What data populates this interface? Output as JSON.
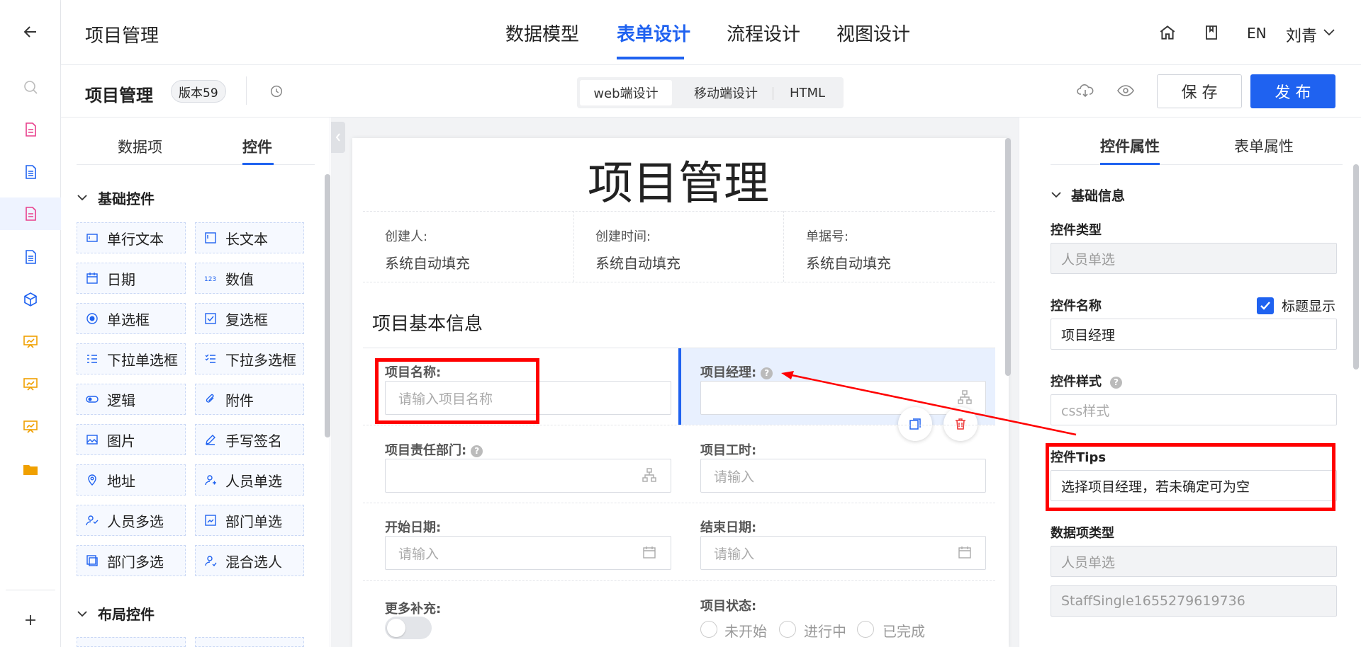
{
  "app": {
    "title": "项目管理"
  },
  "top_nav": {
    "items": [
      "数据模型",
      "表单设计",
      "流程设计",
      "视图设计"
    ],
    "active": "表单设计"
  },
  "header_right": {
    "lang": "EN",
    "user": "刘青"
  },
  "subheader": {
    "title": "项目管理",
    "version": "版本59",
    "modes": [
      "web端设计",
      "移动端设计",
      "HTML"
    ],
    "active_mode": "web端设计",
    "save_label": "保 存",
    "publish_label": "发 布"
  },
  "palette": {
    "tabs": [
      "数据项",
      "控件"
    ],
    "active_tab": "控件",
    "basic_title": "基础控件",
    "controls": [
      "单行文本",
      "长文本",
      "日期",
      "数值",
      "单选框",
      "复选框",
      "下拉单选框",
      "下拉多选框",
      "逻辑",
      "附件",
      "图片",
      "手写签名",
      "地址",
      "人员单选",
      "人员多选",
      "部门单选",
      "部门多选",
      "混合选人"
    ],
    "layout_title": "布局控件"
  },
  "form": {
    "title": "项目管理",
    "meta": [
      {
        "label": "创建人:",
        "value": "系统自动填充"
      },
      {
        "label": "创建时间:",
        "value": "系统自动填充"
      },
      {
        "label": "单据号:",
        "value": "系统自动填充"
      }
    ],
    "section_title": "项目基本信息",
    "fields": {
      "project_name": {
        "label": "项目名称:",
        "placeholder": "请输入项目名称"
      },
      "project_manager": {
        "label": "项目经理:"
      },
      "department": {
        "label": "项目责任部门:"
      },
      "work_hours": {
        "label": "项目工时:",
        "placeholder": "请输入"
      },
      "start_date": {
        "label": "开始日期:",
        "placeholder": "请输入"
      },
      "end_date": {
        "label": "结束日期:",
        "placeholder": "请输入"
      },
      "more": {
        "label": "更多补充:"
      },
      "status": {
        "label": "项目状态:",
        "options": [
          "未开始",
          "进行中",
          "已完成"
        ]
      }
    }
  },
  "props": {
    "tabs": [
      "控件属性",
      "表单属性"
    ],
    "active_tab": "控件属性",
    "section": "基础信息",
    "control_type_label": "控件类型",
    "control_type_value": "人员单选",
    "control_name_label": "控件名称",
    "show_title_label": "标题显示",
    "show_title_checked": true,
    "control_name_value": "项目经理",
    "style_label": "控件样式",
    "style_placeholder": "css样式",
    "tips_label": "控件Tips",
    "tips_value": "选择项目经理，若未确定可为空",
    "data_type_label": "数据项类型",
    "data_type_value": "人员单选",
    "code_value": "StaffSingle1655279619736"
  },
  "colors": {
    "accent": "#1f62f0",
    "annotation": "#ff0000"
  }
}
